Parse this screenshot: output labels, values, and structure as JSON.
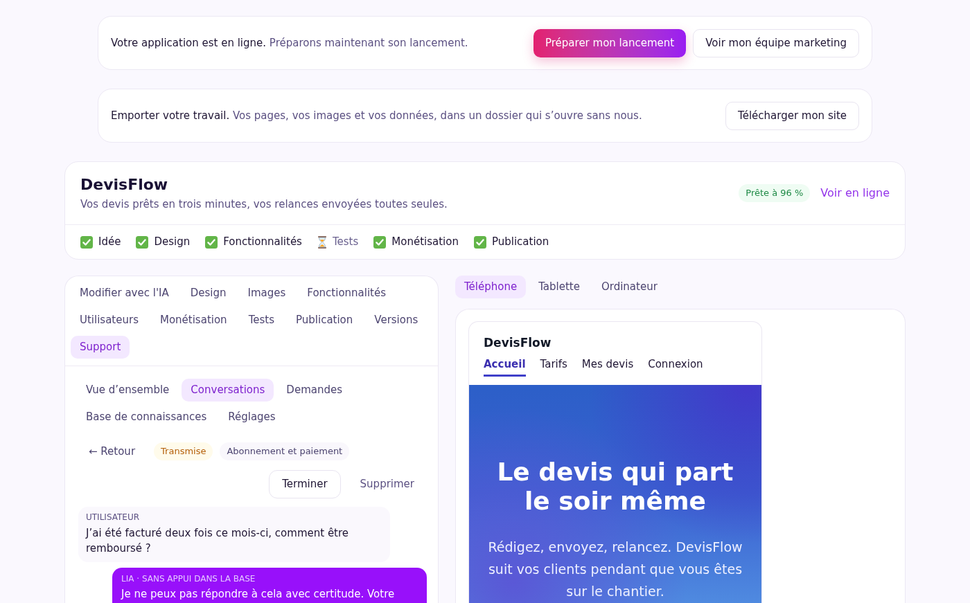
{
  "banners": [
    {
      "lead": "Votre application est en ligne.",
      "text": "Préparons maintenant son lancement.",
      "buttons": [
        {
          "label": "Préparer mon lancement",
          "kind": "primary"
        },
        {
          "label": "Voir mon équipe marketing",
          "kind": "secondary"
        }
      ]
    },
    {
      "lead": "Emporter votre travail.",
      "text": "Vos pages, vos images et vos données, dans un dossier qui s’ouvre sans nous.",
      "buttons": [
        {
          "label": "Télécharger mon site",
          "kind": "secondary"
        }
      ]
    }
  ],
  "project": {
    "title": "DevisFlow",
    "tagline": "Vos devis prêts en trois minutes, vos relances envoyées toutes seules.",
    "readiness": "Prête à 96 %",
    "link": "Voir en ligne",
    "steps": [
      {
        "label": "Idée",
        "done": true
      },
      {
        "label": "Design",
        "done": true
      },
      {
        "label": "Fonctionnalités",
        "done": true
      },
      {
        "label": "Tests",
        "done": false
      },
      {
        "label": "Monétisation",
        "done": true
      },
      {
        "label": "Publication",
        "done": true
      }
    ]
  },
  "editor": {
    "tabs": [
      {
        "label": "Modifier avec l'IA",
        "selected": false
      },
      {
        "label": "Design",
        "selected": false
      },
      {
        "label": "Images",
        "selected": false
      },
      {
        "label": "Fonctionnalités",
        "selected": false
      },
      {
        "label": "Utilisateurs",
        "selected": false
      },
      {
        "label": "Monétisation",
        "selected": false
      },
      {
        "label": "Tests",
        "selected": false
      },
      {
        "label": "Publication",
        "selected": false
      },
      {
        "label": "Versions",
        "selected": false
      },
      {
        "label": "Support",
        "selected": true
      }
    ],
    "subtabs": [
      {
        "label": "Vue d’ensemble",
        "selected": false
      },
      {
        "label": "Conversations",
        "selected": true
      },
      {
        "label": "Demandes",
        "selected": false
      },
      {
        "label": "Base de connaissances",
        "selected": false
      },
      {
        "label": "Réglages",
        "selected": false
      }
    ],
    "conversation": {
      "back": "← Retour",
      "status": "Transmise",
      "topic": "Abonnement et paiement",
      "actions": [
        {
          "label": "Terminer",
          "kind": "outline"
        },
        {
          "label": "Supprimer",
          "kind": "ghost"
        }
      ],
      "messages": [
        {
          "kind": "user",
          "author": "UTILISATEUR",
          "text": "J’ai été facturé deux fois ce mois-ci, comment être remboursé ?"
        },
        {
          "kind": "assistant",
          "author": "LIA · SANS APPUI DANS LA BASE",
          "text": "Je ne peux pas répondre à cela avec certitude. Votre"
        }
      ]
    }
  },
  "preview": {
    "devices": [
      {
        "label": "Téléphone",
        "selected": true
      },
      {
        "label": "Tablette",
        "selected": false
      },
      {
        "label": "Ordinateur",
        "selected": false
      }
    ],
    "site": {
      "brand": "DevisFlow",
      "nav": [
        {
          "label": "Accueil",
          "selected": true
        },
        {
          "label": "Tarifs",
          "selected": false
        },
        {
          "label": "Mes devis",
          "selected": false
        },
        {
          "label": "Connexion",
          "selected": false
        }
      ],
      "hero_title": "Le devis qui part le soir même",
      "hero_text": "Rédigez, envoyez, relancez. DevisFlow suit vos clients pendant que vous êtes sur le chantier."
    }
  }
}
